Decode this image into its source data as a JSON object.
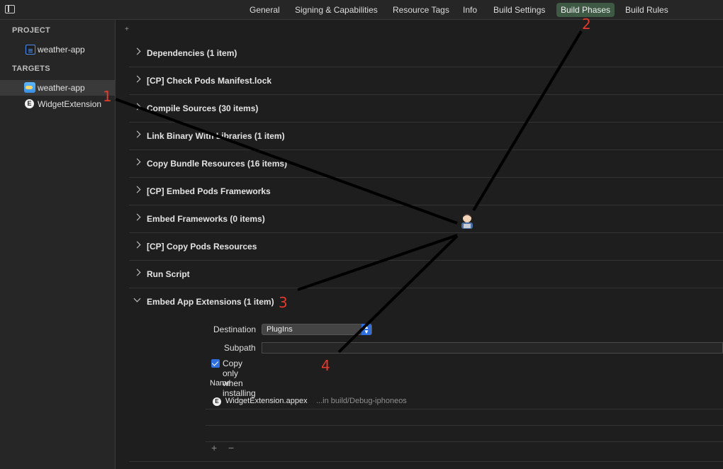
{
  "tabs": [
    {
      "label": "General"
    },
    {
      "label": "Signing & Capabilities"
    },
    {
      "label": "Resource Tags"
    },
    {
      "label": "Info"
    },
    {
      "label": "Build Settings"
    },
    {
      "label": "Build Phases",
      "active": true
    },
    {
      "label": "Build Rules"
    }
  ],
  "sidebar": {
    "project_header": "PROJECT",
    "project_item": "weather-app",
    "targets_header": "TARGETS",
    "targets": [
      "weather-app",
      "WidgetExtension"
    ]
  },
  "main": {
    "add_symbol": "+",
    "phases": [
      "Dependencies (1 item)",
      "[CP] Check Pods Manifest.lock",
      "Compile Sources (30 items)",
      "Link Binary With Libraries (1 item)",
      "Copy Bundle Resources (16 items)",
      "[CP] Embed Pods Frameworks",
      "Embed Frameworks (0 items)",
      "[CP] Copy Pods Resources",
      "Run Script",
      "Embed App Extensions (1 item)"
    ],
    "embed": {
      "destination_label": "Destination",
      "destination_value": "PlugIns",
      "subpath_label": "Subpath",
      "subpath_value": "",
      "copy_only_label": "Copy only when installing",
      "copy_only_checked": true,
      "name_header": "Name",
      "file_name": "WidgetExtension.appex",
      "file_location": "...in build/Debug-iphoneos",
      "add_symbol": "+",
      "remove_symbol": "−"
    }
  },
  "annotations": {
    "markers": [
      "1",
      "2",
      "3",
      "4"
    ],
    "line_color": "#000000",
    "marker_color": "#e33a2c"
  },
  "colors": {
    "active_tab": "#3e5a45",
    "accent": "#2f6fe0"
  }
}
